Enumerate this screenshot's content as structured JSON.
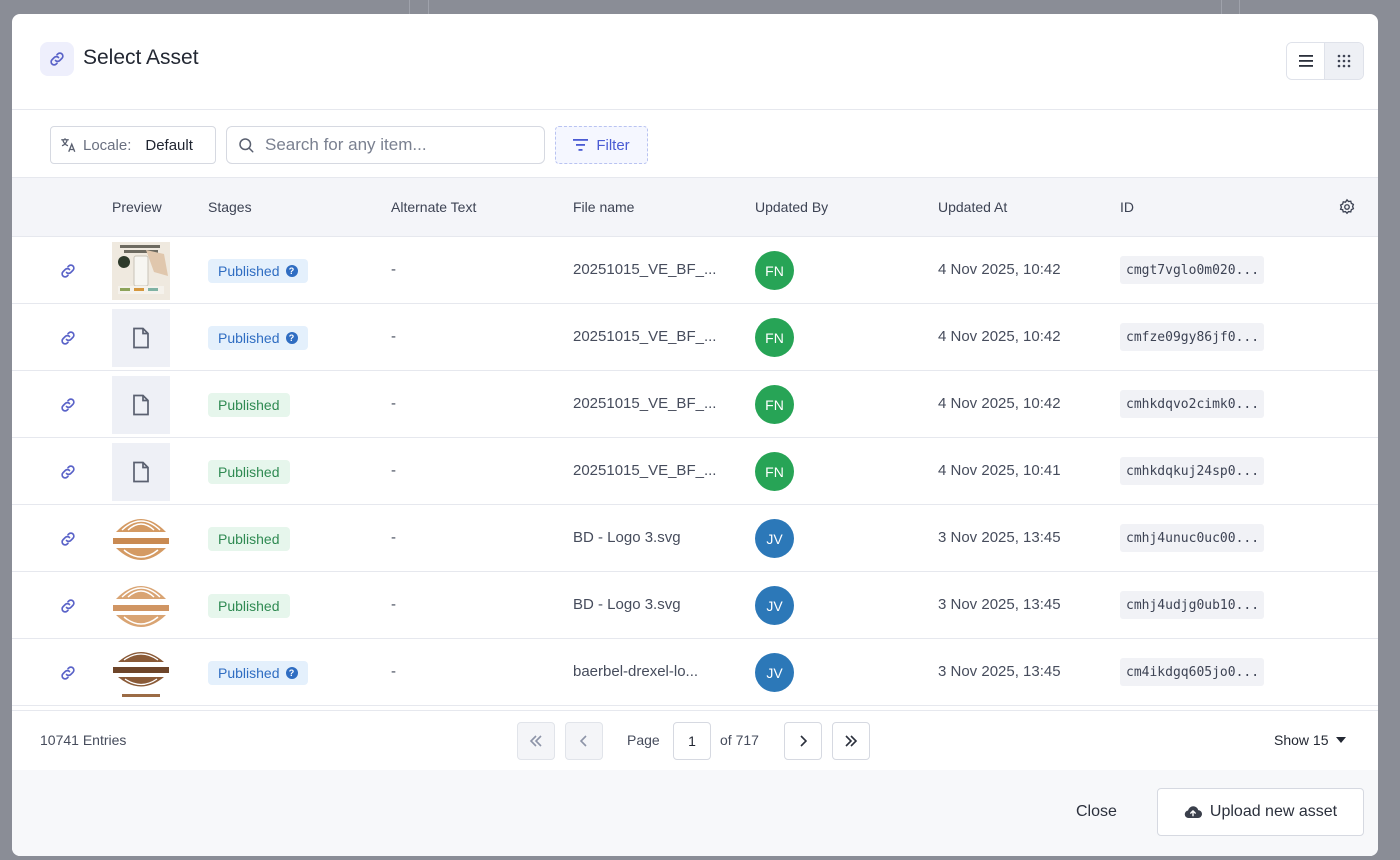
{
  "modal": {
    "title": "Select Asset",
    "view_modes": [
      "list-icon",
      "grid-icon"
    ]
  },
  "toolbar": {
    "locale_label": "Locale:",
    "locale_value": "Default",
    "search_placeholder": "Search for any item...",
    "filter_label": "Filter"
  },
  "table": {
    "columns": {
      "preview": "Preview",
      "stages": "Stages",
      "alt": "Alternate Text",
      "file": "File name",
      "updated_by": "Updated By",
      "updated_at": "Updated At",
      "id": "ID"
    },
    "rows": [
      {
        "preview": "image",
        "stage": "Published",
        "alt": "-",
        "file": "20251015_VE_BF_...",
        "user": "FN",
        "updated": "4 Nov 2025, 10:42",
        "id": "cmgt7vglo0m020..."
      },
      {
        "preview": "document",
        "stage": "Published",
        "alt": "-",
        "file": "20251015_VE_BF_...",
        "user": "FN",
        "updated": "4 Nov 2025, 10:42",
        "id": "cmfze09gy86jf0..."
      },
      {
        "preview": "document",
        "stage": "Published",
        "alt": "-",
        "file": "20251015_VE_BF_...",
        "user": "FN",
        "updated": "4 Nov 2025, 10:42",
        "id": "cmhkdqvo2cimk0..."
      },
      {
        "preview": "document",
        "stage": "Published",
        "alt": "-",
        "file": "20251015_VE_BF_...",
        "user": "FN",
        "updated": "4 Nov 2025, 10:41",
        "id": "cmhkdqkuj24sp0..."
      },
      {
        "preview": "logo",
        "stage": "Published",
        "alt": "-",
        "file": "BD - Logo 3.svg",
        "user": "JV",
        "updated": "3 Nov 2025, 13:45",
        "id": "cmhj4unuc0uc00..."
      },
      {
        "preview": "logo",
        "stage": "Published",
        "alt": "-",
        "file": "BD - Logo 3.svg",
        "user": "JV",
        "updated": "3 Nov 2025, 13:45",
        "id": "cmhj4udjg0ub10..."
      },
      {
        "preview": "logo-dark",
        "stage": "Published",
        "alt": "-",
        "file": "baerbel-drexel-lo...",
        "user": "JV",
        "updated": "3 Nov 2025, 13:45",
        "id": "cm4ikdgq605jo0..."
      }
    ]
  },
  "pagination": {
    "entries": "10741 Entries",
    "page_label": "Page",
    "page": "1",
    "of": "of 717",
    "show": "Show 15"
  },
  "footer": {
    "close": "Close",
    "upload": "Upload new asset"
  },
  "colors": {
    "accent": "#4a5bd4",
    "published_blue": "#2f6dc2",
    "published_green": "#2f8a52",
    "avatar_fn": "#27a456",
    "avatar_jv": "#2c78b8"
  }
}
